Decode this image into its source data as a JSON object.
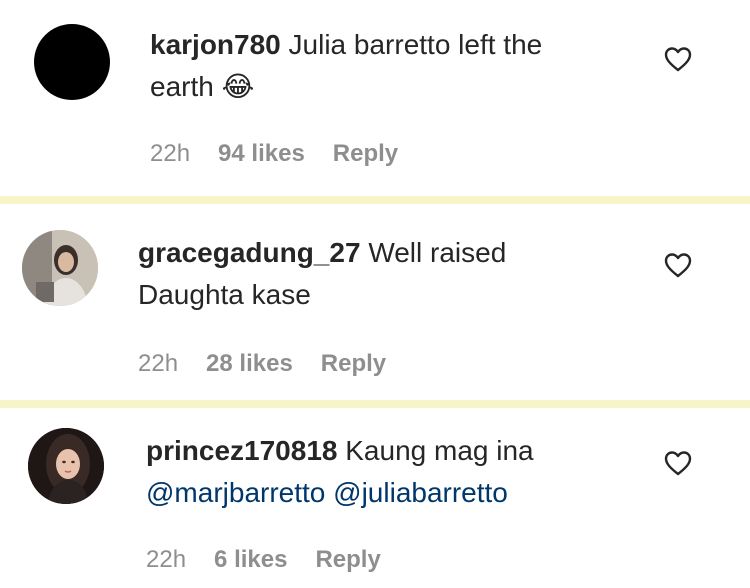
{
  "comments": [
    {
      "username": "karjon780",
      "text_line1": "Julia barretto left the",
      "text_line2": "earth",
      "emoji": "😂",
      "time": "22h",
      "likes": "94 likes",
      "reply": "Reply"
    },
    {
      "username": "gracegadung_27",
      "text_line1": "Well raised",
      "text_line2": "Daughta kase",
      "time": "22h",
      "likes": "28 likes",
      "reply": "Reply"
    },
    {
      "username": "princez170818",
      "text_line1": "Kaung mag ina",
      "mention1": "@marjbarretto",
      "mention2": "@juliabarretto",
      "time": "22h",
      "likes": "6 likes",
      "reply": "Reply"
    }
  ],
  "colors": {
    "text": "#262626",
    "secondary": "#8e8e8e",
    "mention": "#00376b",
    "separator": "#f7f4c8"
  },
  "icons": {
    "like": "heart-outline-icon"
  }
}
